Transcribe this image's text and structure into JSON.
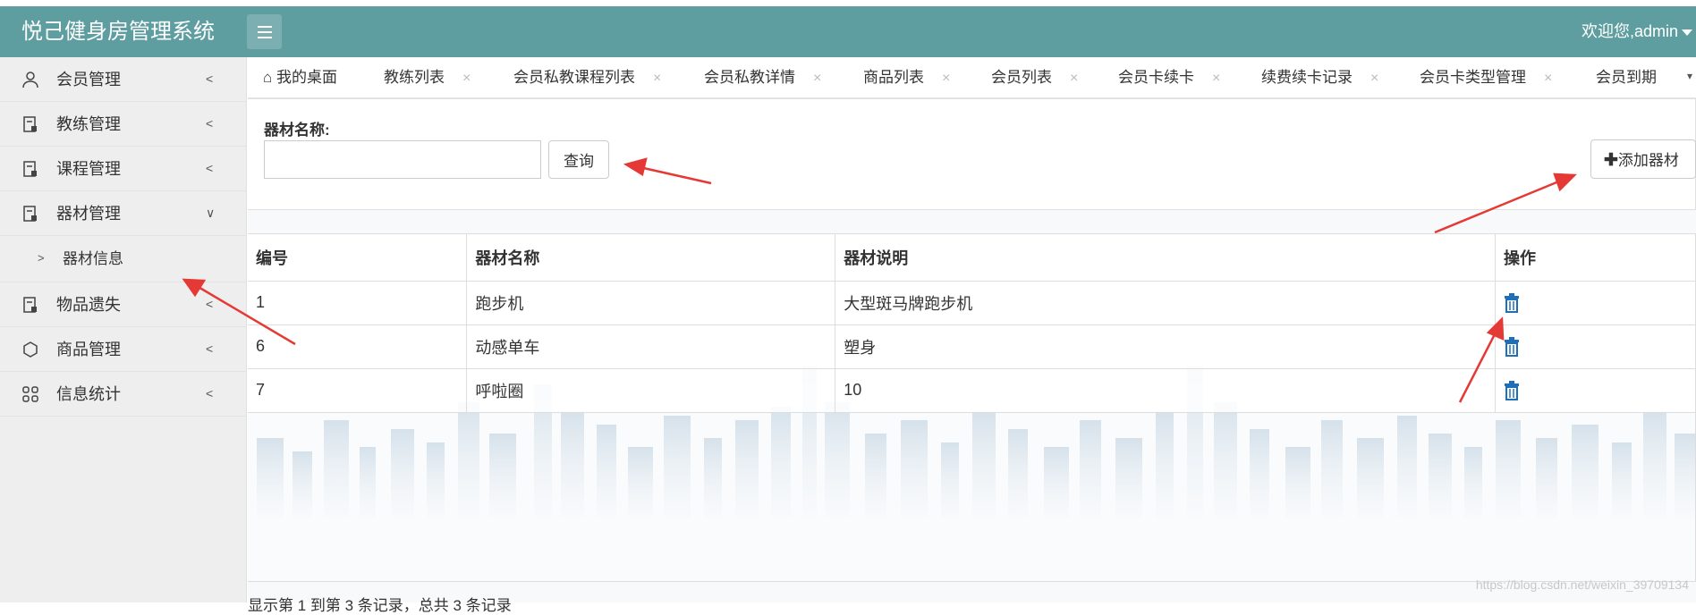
{
  "header": {
    "app_title": "悦己健身房管理系统",
    "welcome_text": "欢迎您,admin",
    "menu_toggle_icon": "list-icon",
    "color": "#5f9ea0"
  },
  "sidebar": {
    "items": [
      {
        "label": "会员管理",
        "icon": "user-icon",
        "chevron": "<"
      },
      {
        "label": "教练管理",
        "icon": "document-icon",
        "chevron": "<"
      },
      {
        "label": "课程管理",
        "icon": "document-icon",
        "chevron": "<"
      },
      {
        "label": "器材管理",
        "icon": "document-icon",
        "chevron": "∨"
      },
      {
        "label": "物品遗失",
        "icon": "document-icon",
        "chevron": "<"
      },
      {
        "label": "商品管理",
        "icon": "package-icon",
        "chevron": "<"
      },
      {
        "label": "信息统计",
        "icon": "grid-icon",
        "chevron": "<"
      }
    ],
    "sub_item": {
      "label": "器材信息",
      "arrow": ">"
    }
  },
  "tabs": [
    {
      "label": "我的桌面",
      "icon": "home-icon"
    },
    {
      "label": "教练列表"
    },
    {
      "label": "会员私教课程列表"
    },
    {
      "label": "会员私教详情"
    },
    {
      "label": "商品列表"
    },
    {
      "label": "会员列表"
    },
    {
      "label": "会员卡续卡"
    },
    {
      "label": "续费续卡记录"
    },
    {
      "label": "会员卡类型管理"
    },
    {
      "label": "会员到期"
    }
  ],
  "tab_close_glyph": "×",
  "search": {
    "label": "器材名称:",
    "value": "",
    "placeholder": "",
    "query_button": "查询",
    "add_button": "添加器材"
  },
  "table": {
    "headers": [
      "编号",
      "器材名称",
      "器材说明",
      "操作"
    ],
    "rows": [
      {
        "id": "1",
        "name": "跑步机",
        "desc": "大型斑马牌跑步机",
        "action_icon": "trash-icon"
      },
      {
        "id": "6",
        "name": "动感单车",
        "desc": "塑身",
        "action_icon": "trash-icon"
      },
      {
        "id": "7",
        "name": "呼啦圈",
        "desc": "10",
        "action_icon": "trash-icon"
      }
    ],
    "delete_color": "#1e6fb8"
  },
  "pager_text": "显示第 1 到第 3 条记录，总共 3 条记录",
  "watermark": "https://blog.csdn.net/weixin_39709134",
  "annotation_color": "#e53935"
}
